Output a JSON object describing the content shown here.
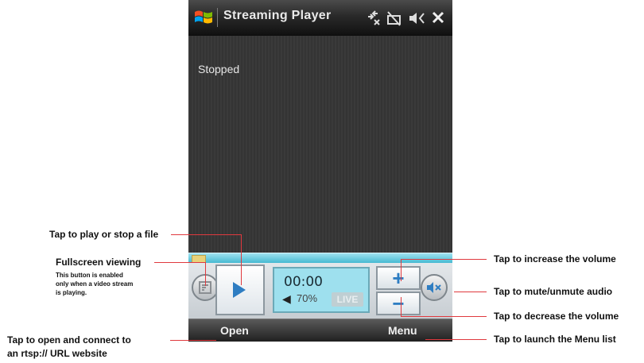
{
  "app": {
    "title": "Streaming Player",
    "status": "Stopped"
  },
  "player": {
    "time": "00:00",
    "volume": "70%",
    "live_label": "LIVE"
  },
  "softkeys": {
    "left": "Open",
    "right": "Menu"
  },
  "callouts": {
    "play": "Tap to play or stop a file",
    "fullscreen": "Fullscreen viewing",
    "fullscreen_note_1": "This button is enabled",
    "fullscreen_note_2": "only when a video stream",
    "fullscreen_note_3": "is playing.",
    "open_1": "Tap to open and  connect to",
    "open_2": "an rtsp:// URL website",
    "increase": "Tap to increase the volume",
    "mute": "Tap to mute/unmute audio",
    "decrease": "Tap to decrease the volume",
    "menu": "Tap to launch the Menu list"
  },
  "icons": [
    "windows-start-icon",
    "connectivity-icon",
    "battery-icon",
    "speaker-icon",
    "close-icon",
    "play-icon",
    "fullscreen-icon",
    "plus-icon",
    "minus-icon",
    "mute-icon"
  ],
  "colors": {
    "callout_line": "#e0393e",
    "accent": "#2e7dc2",
    "progress": "#3fb6cf"
  }
}
